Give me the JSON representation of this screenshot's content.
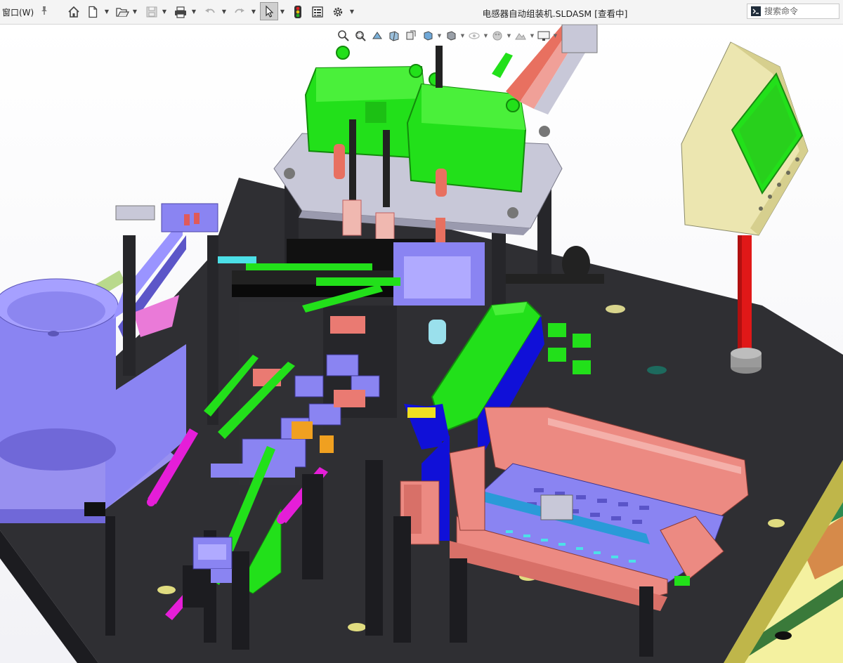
{
  "titlebar": {
    "window_menu": "窗口(W)",
    "document_title": "电感器自动组装机.SLDASM [查看中]"
  },
  "search": {
    "placeholder": "搜索命令"
  },
  "toolbar": {
    "icons": [
      "home-icon",
      "new-document-icon",
      "open-folder-icon",
      "save-icon",
      "print-icon",
      "undo-icon",
      "redo-icon",
      "select-pointer-icon",
      "traffic-light-icon",
      "options-list-icon",
      "gear-icon"
    ]
  },
  "heads_up_toolbar": {
    "icons": [
      "zoom-to-fit-icon",
      "zoom-to-area-icon",
      "previous-view-icon",
      "section-view-icon",
      "dynamic-annotation-icon",
      "view-orientation-icon",
      "display-style-icon",
      "hide-show-items-icon",
      "edit-appearance-icon",
      "apply-scene-icon",
      "view-settings-icon"
    ]
  },
  "colors": {
    "titlebar_bg": "#f4f4f4",
    "viewport_bg": "#ffffff",
    "table_dark": "#2f2f33",
    "part_green": "#22e01a",
    "part_lavender": "#8a84f2",
    "part_salmon": "#ec8a82",
    "part_magenta": "#e51ed8",
    "part_blue": "#1010d8",
    "panel_cream": "#ece6b0",
    "pillar_red": "#e01818",
    "plate_grey": "#c8c8d8"
  }
}
